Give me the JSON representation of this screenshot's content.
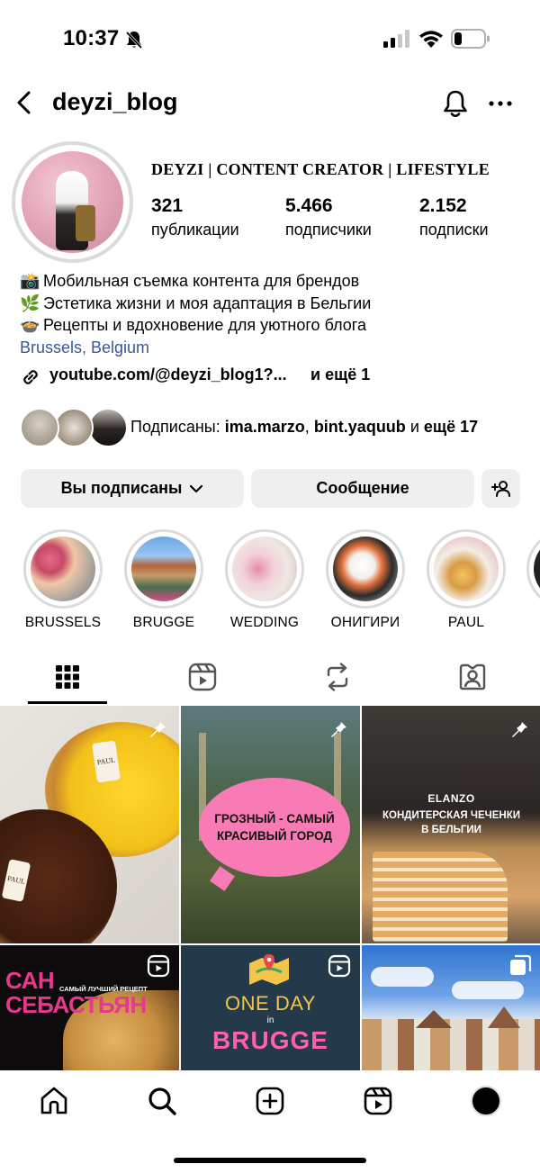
{
  "status_bar": {
    "time": "10:37",
    "battery_level": 0.25
  },
  "header": {
    "username": "deyzi_blog",
    "back_icon": "chevron-left-icon",
    "notify_icon": "bell-icon",
    "more_icon": "ellipsis-icon"
  },
  "profile": {
    "display_name": "DEYZI | CONTENT CREATOR | LIFESTYLE",
    "stats": [
      {
        "value": "321",
        "label": "публикации"
      },
      {
        "value": "5.466",
        "label": "подписчики"
      },
      {
        "value": "2.152",
        "label": "подписки"
      }
    ],
    "bio": [
      {
        "emoji": "📸",
        "text": "Мобильная съемка контента для брендов"
      },
      {
        "emoji": "🌿",
        "text": "Эстетика жизни и моя адаптация в Бельгии"
      },
      {
        "emoji": "🍲",
        "text": "Рецепты и вдохновение для уютного блога"
      }
    ],
    "location": "Brussels, Belgium",
    "link": "youtube.com/@deyzi_blog1?...",
    "link_more": "и ещё 1"
  },
  "followed_by": {
    "prefix": "Подписаны: ",
    "user1": "ima.marzo",
    "sep": ", ",
    "user2": "bint.yaquub",
    "and": " и ",
    "more": "ещё 17"
  },
  "buttons": {
    "following": "Вы подписаны",
    "message": "Сообщение"
  },
  "highlights": [
    {
      "label": "BRUSSELS"
    },
    {
      "label": "BRUGGE"
    },
    {
      "label": "WEDDING"
    },
    {
      "label": "ОНИГИРИ"
    },
    {
      "label": "PAUL"
    }
  ],
  "tabs": [
    "grid-icon",
    "reels-icon",
    "repost-icon",
    "tagged-icon"
  ],
  "grid": {
    "tile2_text": "ГРОЗНЫЙ - САМЫЙ КРАСИВЫЙ ГОРОД",
    "tile3_brand": "ELANZO",
    "tile3_text": "КОНДИТЕРСКАЯ ЧЕЧЕНКИ В БЕЛЬГИИ",
    "tile4_title": "САН СЕБАСТЬЯН",
    "tile4_sub": "САМЫЙ ЛУЧШИЙ РЕЦЕПТ",
    "tile5_line1": "ONE DAY",
    "tile5_line2": "in",
    "tile5_line3": "BRUGGE"
  },
  "bottom_nav": [
    "home-icon",
    "search-icon",
    "create-icon",
    "reels-icon",
    "profile-icon"
  ]
}
